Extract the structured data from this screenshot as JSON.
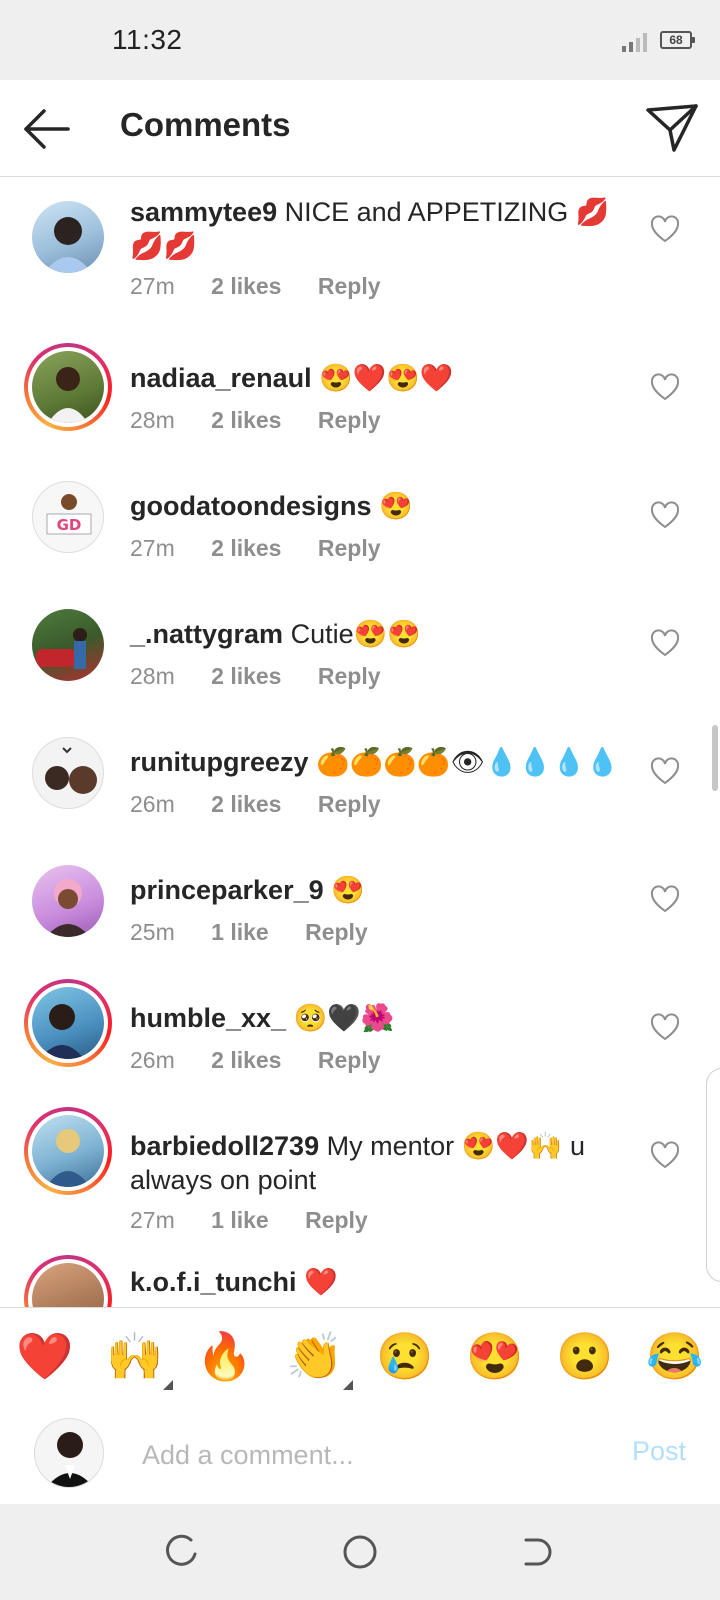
{
  "status": {
    "time": "11:32",
    "battery": "68"
  },
  "header": {
    "title": "Comments"
  },
  "comments": [
    {
      "user": "sammytee9",
      "text": " NICE and APPETIZING 💋💋💋",
      "time": "27m",
      "likes": "2 likes",
      "reply": "Reply"
    },
    {
      "user": "nadiaa_renaul",
      "text": " 😍❤️😍❤️",
      "time": "28m",
      "likes": "2 likes",
      "reply": "Reply"
    },
    {
      "user": "goodatoondesigns",
      "text": " 😍",
      "time": "27m",
      "likes": "2 likes",
      "reply": "Reply"
    },
    {
      "user": "_.nattygram",
      "text": " Cutie😍😍",
      "time": "28m",
      "likes": "2 likes",
      "reply": "Reply"
    },
    {
      "user": "runitupgreezy",
      "text": " 🍊🍊🍊🍊👁💧💧💧💧",
      "time": "26m",
      "likes": "2 likes",
      "reply": "Reply"
    },
    {
      "user": "princeparker_9",
      "text": " 😍",
      "time": "25m",
      "likes": "1 like",
      "reply": "Reply"
    },
    {
      "user": "humble_xx_",
      "text": " 🥺🖤🌺",
      "time": "26m",
      "likes": "2 likes",
      "reply": "Reply"
    },
    {
      "user": "barbiedoll2739",
      "text": " My mentor 😍❤️🙌 u always on point",
      "time": "27m",
      "likes": "1 like",
      "reply": "Reply"
    },
    {
      "user": "k.o.f.i_tunchi",
      "text": " ❤️",
      "time": "",
      "likes": "",
      "reply": ""
    }
  ],
  "reactions": [
    "❤️",
    "🙌",
    "🔥",
    "👏",
    "😢",
    "😍",
    "😮",
    "😂"
  ],
  "compose": {
    "placeholder": "Add a comment...",
    "post_label": "Post"
  },
  "colors": {
    "text": "#262626",
    "meta": "#8e8e8e",
    "post_disabled": "#b2dffc",
    "story_ring": "#e1306c"
  },
  "icons": {
    "back": "arrow-left-icon",
    "send": "paper-plane-icon",
    "like": "heart-outline-icon"
  }
}
